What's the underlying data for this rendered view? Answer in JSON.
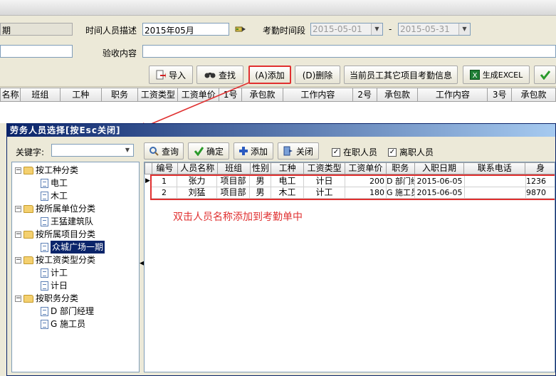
{
  "form": {
    "period_label_partial": "期",
    "time_desc_label": "时间人员描述",
    "time_desc_value": "2015年05月",
    "attend_period_label": "考勤时间段",
    "date_from": "2015-05-01",
    "date_sep": "-",
    "date_to": "2015-05-31",
    "inspection_label": "验收内容",
    "inspection_value": ""
  },
  "toolbar": {
    "import": "导入",
    "find": "查找",
    "add": "(A)添加",
    "delete": "(D)删除",
    "other_info": "当前员工其它项目考勤信息",
    "excel": "生成EXCEL"
  },
  "main_columns": [
    "名称",
    "班组",
    "工种",
    "职务",
    "工资类型",
    "工资单价",
    "1号",
    "承包款",
    "工作内容",
    "2号",
    "承包款",
    "工作内容",
    "3号",
    "承包款"
  ],
  "dialog": {
    "title": "劳务人员选择[按Esc关闭]",
    "keyword_label": "关键字",
    "keyword_value": "",
    "query": "查询",
    "confirm": "确定",
    "add": "添加",
    "close": "关闭",
    "on_job": "在职人员",
    "off_job": "离职人员",
    "tree": [
      {
        "label": "按工种分类",
        "level": 0
      },
      {
        "label": "电工",
        "level": 1
      },
      {
        "label": "木工",
        "level": 1
      },
      {
        "label": "按所属单位分类",
        "level": 0
      },
      {
        "label": "王猛建筑队",
        "level": 1
      },
      {
        "label": "按所属项目分类",
        "level": 0
      },
      {
        "label": "众城广场一期",
        "level": 1,
        "selected": true
      },
      {
        "label": "按工资类型分类",
        "level": 0
      },
      {
        "label": "计工",
        "level": 1
      },
      {
        "label": "计日",
        "level": 1
      },
      {
        "label": "按职务分类",
        "level": 0
      },
      {
        "label": "D 部门经理",
        "level": 1
      },
      {
        "label": "G 施工员",
        "level": 1
      }
    ],
    "columns": [
      "编号",
      "人员名称",
      "班组",
      "性别",
      "工种",
      "工资类型",
      "工资单价",
      "职务",
      "入职日期",
      "联系电话",
      "身"
    ],
    "rows": [
      {
        "id": "1",
        "name": "张力",
        "team": "项目部",
        "sex": "男",
        "trade": "电工",
        "wage_type": "计日",
        "wage": "200",
        "position": "D 部门经",
        "date": "2015-06-05",
        "phone": "",
        "idcard": "1236"
      },
      {
        "id": "2",
        "name": "刘猛",
        "team": "项目部",
        "sex": "男",
        "trade": "木工",
        "wage_type": "计工",
        "wage": "180",
        "position": "G 施工员",
        "date": "2015-06-05",
        "phone": "",
        "idcard": "9870"
      }
    ],
    "annotation": "双击人员名称添加到考勤单中"
  },
  "colors": {
    "highlight": "#e03030",
    "title_bar": "#0a246a",
    "annotation": "#e03030"
  }
}
